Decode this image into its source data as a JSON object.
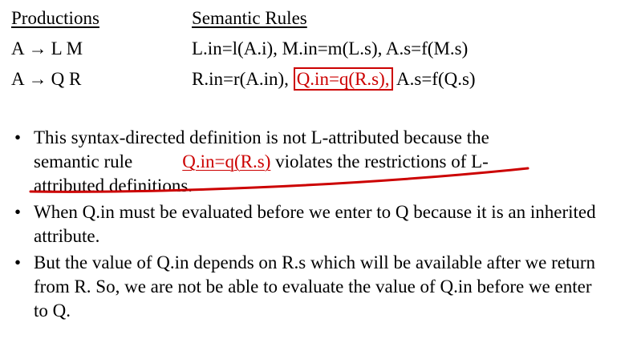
{
  "table": {
    "header_productions": "Productions",
    "header_semantic_rules": "Semantic Rules",
    "rows": [
      {
        "prod_lhs": "A",
        "arrow": "→",
        "prod_rhs": "L M",
        "rule": "L.in=l(A.i), M.in=m(L.s), A.s=f(M.s)"
      },
      {
        "prod_lhs": "A",
        "arrow": "→",
        "prod_rhs": "Q R",
        "rule_part1": "R.in=r(A.in), ",
        "rule_highlight": "Q.in=q(R.s),",
        "rule_part2": " A.s=f(Q.s)"
      }
    ]
  },
  "bullets": {
    "bullet_symbol": "•",
    "b1": {
      "line1": "This syntax-directed definition is not L-attributed because the",
      "line2_prefix": "semantic rule",
      "line2_red": "Q.in=q(R.s)",
      "line2_suffix": "  violates the restrictions of L-",
      "line3": "attributed definitions."
    },
    "b2": "When Q.in must be evaluated before we enter to Q because it is an inherited attribute.",
    "b3": "But the value of Q.in depends on R.s which will be available after we return from R. So, we are not be able to evaluate the value of Q.in before we enter to Q."
  },
  "colors": {
    "accent_red": "#cc0000",
    "text": "#000000",
    "background": "#ffffff"
  }
}
